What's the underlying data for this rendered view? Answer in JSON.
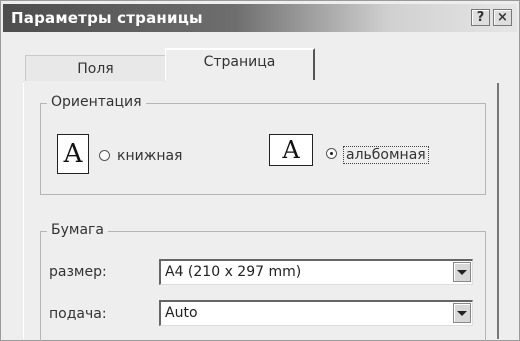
{
  "window": {
    "title": "Параметры страницы",
    "help_label": "?",
    "close_label": "×"
  },
  "tabs": [
    {
      "label": "Поля",
      "selected": false
    },
    {
      "label": "Страница",
      "selected": true
    }
  ],
  "orientation": {
    "legend": "Ориентация",
    "portrait_icon_glyph": "A",
    "landscape_icon_glyph": "A",
    "portrait_label": "книжная",
    "landscape_label": "альбомная",
    "selected": "landscape"
  },
  "paper": {
    "legend": "Бумага",
    "size_label": "размер:",
    "size_value": "A4 (210 x 297 mm)",
    "feed_label": "подача:",
    "feed_value": "Auto"
  },
  "colors": {
    "title_bar_start": "#4d4d4d",
    "title_bar_end": "#e6e6e6",
    "dialog_bg": "#eeeeee"
  }
}
